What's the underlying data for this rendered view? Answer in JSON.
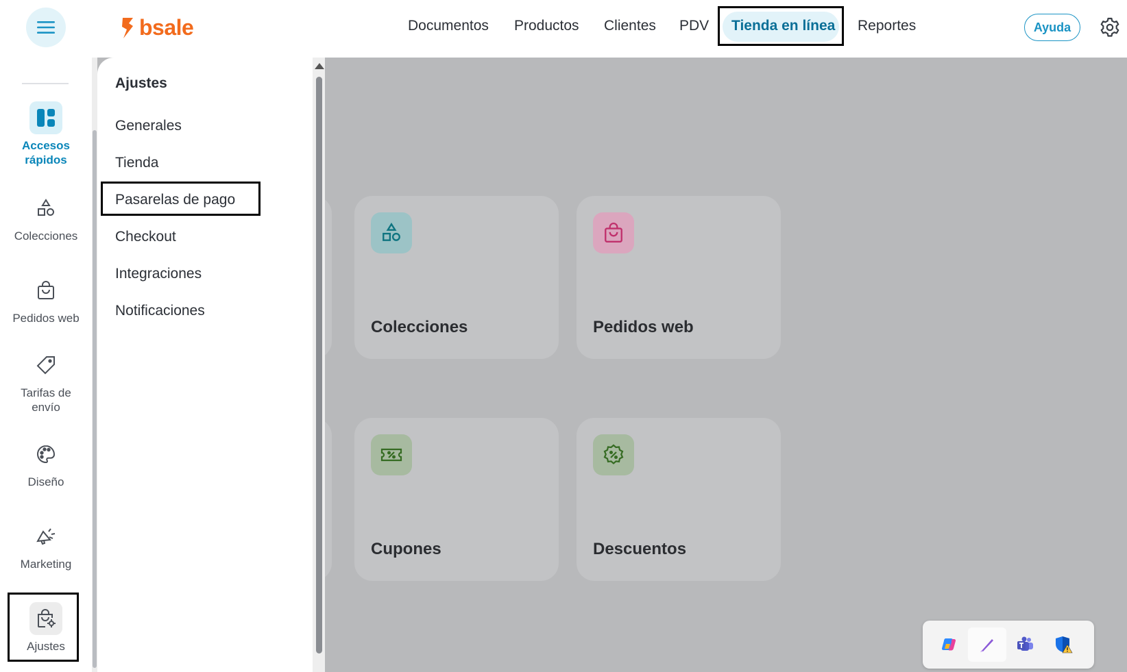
{
  "app": {
    "logo_text": "bsale",
    "brand_color": "#f26b1d",
    "accent_color": "#1a93c4"
  },
  "header": {
    "nav": [
      "Documentos",
      "Productos",
      "Clientes",
      "PDV",
      "Tienda en línea",
      "Reportes"
    ],
    "active_nav": "Tienda en línea",
    "help_label": "Ayuda",
    "menu_icon": "hamburger-icon",
    "settings_icon": "gear-icon"
  },
  "sidebar": {
    "items": [
      {
        "label": "Accesos rápidos",
        "icon": "dashboard-icon",
        "active": true
      },
      {
        "label": "Colecciones",
        "icon": "shapes-icon"
      },
      {
        "label": "Pedidos web",
        "icon": "shopping-bag-icon"
      },
      {
        "label": "Tarifas de envío",
        "icon": "tag-icon"
      },
      {
        "label": "Diseño",
        "icon": "palette-icon"
      },
      {
        "label": "Marketing",
        "icon": "megaphone-icon"
      },
      {
        "label": "Ajustes",
        "icon": "bag-settings-icon",
        "highlighted": true
      }
    ]
  },
  "submenu": {
    "title": "Ajustes",
    "items": [
      "Generales",
      "Tienda",
      "Pasarelas de pago",
      "Checkout",
      "Integraciones",
      "Notificaciones"
    ],
    "highlighted": "Pasarelas de pago"
  },
  "cards": [
    {
      "title": "Colecciones",
      "icon": "shapes-icon",
      "icon_bg": "#9cc3c6",
      "icon_color": "#0e7480"
    },
    {
      "title": "Pedidos web",
      "icon": "shopping-bag-icon",
      "icon_bg": "#dba6be",
      "icon_color": "#c0306c"
    },
    {
      "title": "Cupones",
      "icon": "ticket-icon",
      "icon_bg": "#a7baa0",
      "icon_color": "#356b22"
    },
    {
      "title": "Descuentos",
      "icon": "discount-badge-icon",
      "icon_bg": "#a7baa0",
      "icon_color": "#356b22"
    }
  ],
  "tray": {
    "icons": [
      "copilot-icon",
      "pen-icon",
      "teams-icon",
      "defender-warning-icon"
    ]
  }
}
